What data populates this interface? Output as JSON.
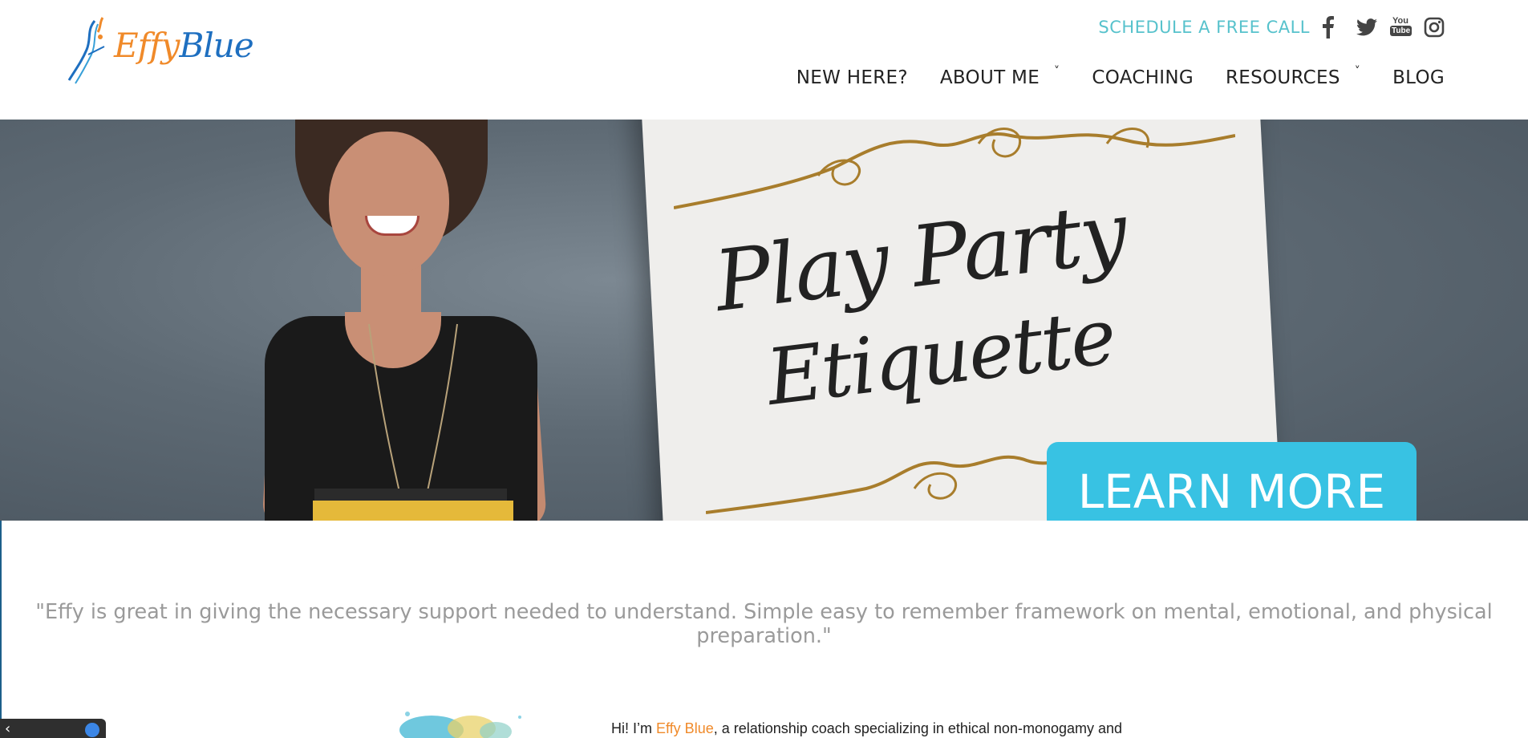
{
  "header": {
    "logo": {
      "word1": "Effy",
      "word2": "Blue"
    },
    "cta": "SCHEDULE A FREE CALL",
    "social": [
      "facebook-icon",
      "twitter-icon",
      "youtube-icon",
      "instagram-icon"
    ],
    "youtube_glyph": {
      "top": "You",
      "bottom": "Tube"
    },
    "nav": [
      {
        "label": "NEW HERE?",
        "dropdown": false
      },
      {
        "label": "ABOUT ME",
        "dropdown": true,
        "caret": "˅"
      },
      {
        "label": "COACHING",
        "dropdown": false
      },
      {
        "label": "RESOURCES",
        "dropdown": true,
        "caret": "˅"
      },
      {
        "label": "BLOG",
        "dropdown": false
      }
    ]
  },
  "hero": {
    "card_line1": "Play Party",
    "card_line2": "Etiquette",
    "button": "LEARN MORE"
  },
  "testimonial": "\"Effy is great in giving the necessary support needed to understand. Simple easy to remember framework on mental, emotional, and physical preparation.\"",
  "intro": {
    "prefix": "Hi! I’m ",
    "name": "Effy Blue",
    "suffix": ", a relationship coach specializing in ethical non-monogamy and"
  },
  "widget": {
    "arrow": "‹"
  },
  "colors": {
    "accent_teal": "#57c2cc",
    "button_blue": "#38c2e3",
    "brand_orange": "#f08a2a",
    "brand_blue": "#1e6fc0"
  }
}
